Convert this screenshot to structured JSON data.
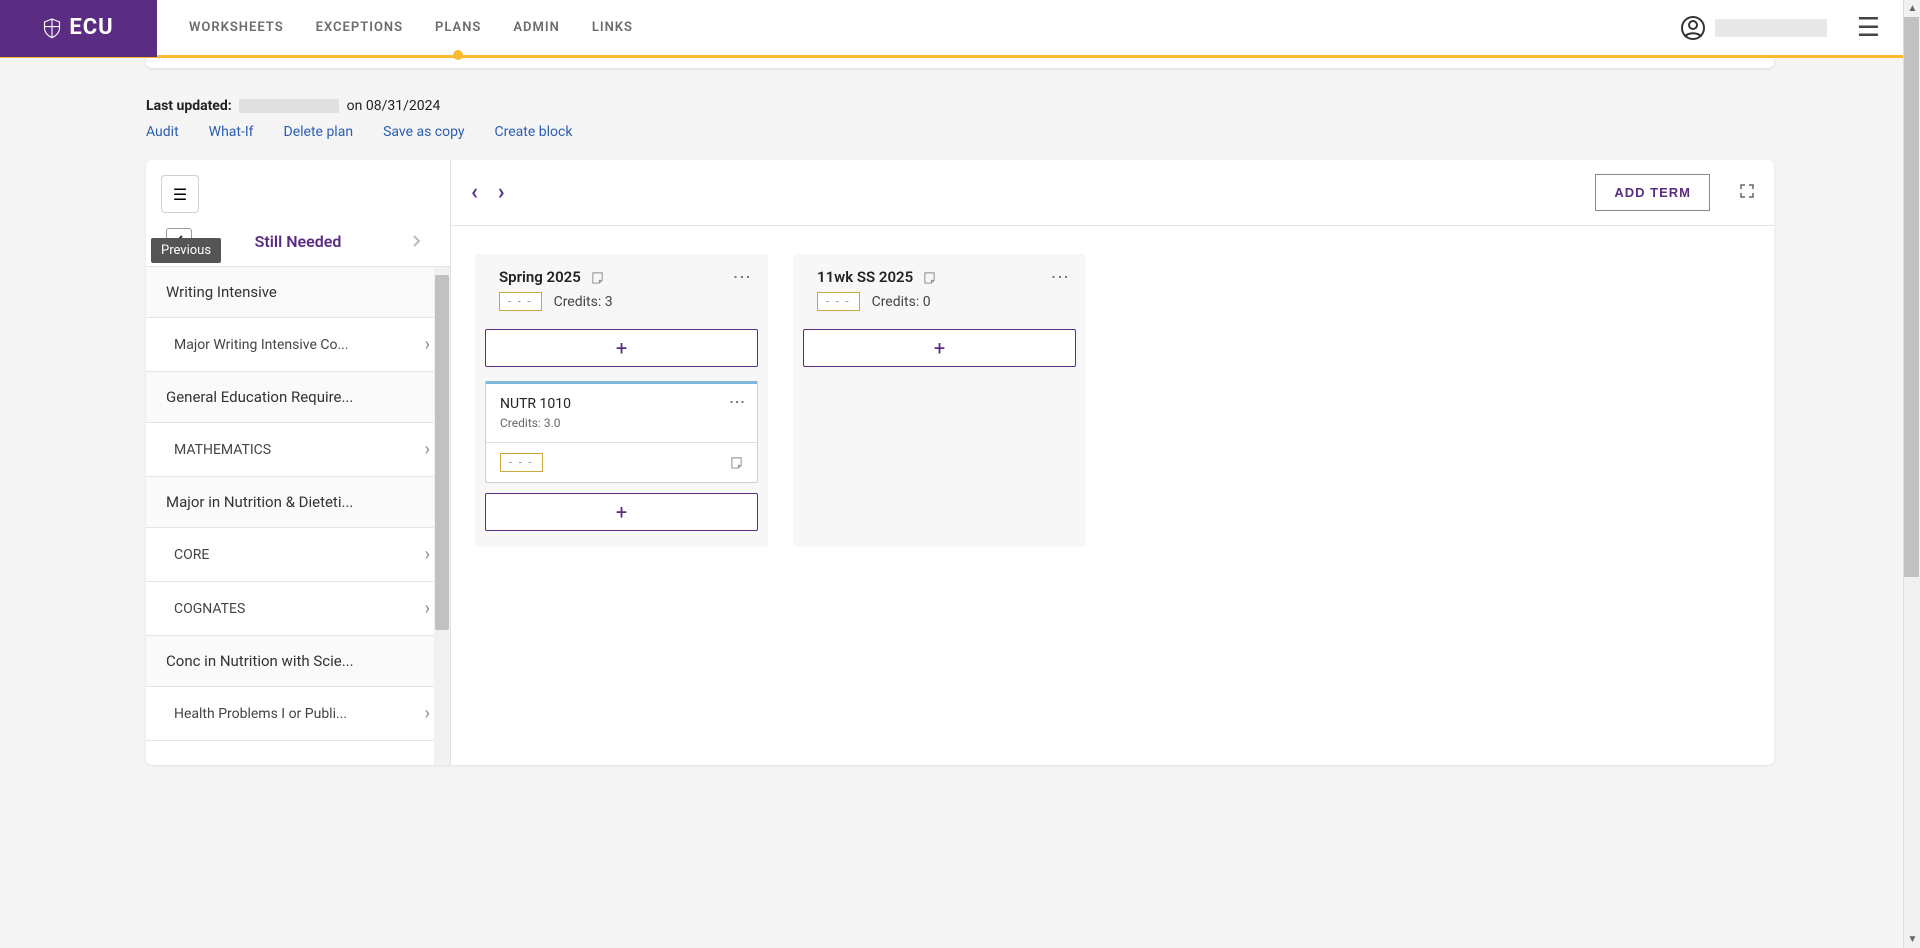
{
  "brand": {
    "name": "ECU"
  },
  "nav": {
    "items": [
      {
        "label": "WORKSHEETS",
        "active": false
      },
      {
        "label": "EXCEPTIONS",
        "active": false
      },
      {
        "label": "PLANS",
        "active": true
      },
      {
        "label": "ADMIN",
        "active": false
      },
      {
        "label": "LINKS",
        "active": false
      }
    ]
  },
  "meta": {
    "last_updated_label": "Last updated:",
    "on_label": "on",
    "date": "08/31/2024"
  },
  "actions": {
    "audit": "Audit",
    "whatif": "What-If",
    "delete": "Delete plan",
    "save": "Save as copy",
    "create": "Create block"
  },
  "sidebar": {
    "title": "Still Needed",
    "tooltip": "Previous",
    "groups": [
      {
        "type": "header",
        "label": "Writing Intensive"
      },
      {
        "type": "item",
        "label": "Major Writing Intensive Co..."
      },
      {
        "type": "header",
        "label": "General Education Require..."
      },
      {
        "type": "item",
        "label": "MATHEMATICS"
      },
      {
        "type": "header",
        "label": "Major in Nutrition & Dieteti..."
      },
      {
        "type": "item",
        "label": "CORE"
      },
      {
        "type": "item",
        "label": "COGNATES"
      },
      {
        "type": "header",
        "label": "Conc in Nutrition with Scie..."
      },
      {
        "type": "item",
        "label": "Health Problems I or Publi..."
      }
    ]
  },
  "plan": {
    "add_term_label": "ADD TERM",
    "terms": [
      {
        "name": "Spring 2025",
        "credits_label": "Credits:",
        "credits": "3",
        "badge": "- - -",
        "courses": [
          {
            "code": "NUTR 1010",
            "credits_label": "Credits:",
            "credits": "3.0",
            "badge": "- - -"
          }
        ]
      },
      {
        "name": "11wk SS 2025",
        "credits_label": "Credits:",
        "credits": "0",
        "badge": "- - -",
        "courses": []
      }
    ]
  }
}
